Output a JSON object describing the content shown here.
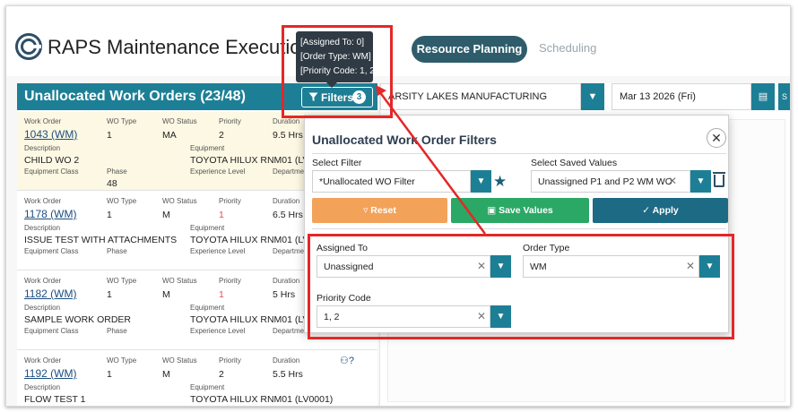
{
  "header": {
    "app_title": "RAPS Maintenance Execution P",
    "tabs": [
      "Resource Planning",
      "Scheduling"
    ]
  },
  "left_panel": {
    "title": "Unallocated Work Orders (23/48)",
    "filters_label": "Filters",
    "filters_count": "3",
    "labels": {
      "work_order": "Work Order",
      "wo_type": "WO Type",
      "wo_status": "WO Status",
      "priority": "Priority",
      "duration": "Duration",
      "description": "Description",
      "equipment": "Equipment",
      "equipment_class": "Equipment Class",
      "phase": "Phase",
      "experience_level": "Experience Level",
      "department": "Departme"
    },
    "work_orders": [
      {
        "number": "1043 (WM)",
        "type": "1",
        "status": "MA",
        "priority": "2",
        "duration": "9.5 Hrs",
        "description": "CHILD WO 2",
        "equipment": "TOYOTA HILUX RNM01 (LV0",
        "phase": "48"
      },
      {
        "number": "1178 (WM)",
        "type": "1",
        "status": "M",
        "priority": "1",
        "duration": "6.5 Hrs",
        "description": "ISSUE TEST WITH ATTACHMENTS",
        "equipment": "TOYOTA HILUX RNM01 (LV0",
        "phase": ""
      },
      {
        "number": "1182 (WM)",
        "type": "1",
        "status": "M",
        "priority": "1",
        "duration": "5 Hrs",
        "description": "SAMPLE WORK ORDER",
        "equipment": "TOYOTA HILUX RNM01 (LV0",
        "phase": ""
      },
      {
        "number": "1192 (WM)",
        "type": "1",
        "status": "M",
        "priority": "2",
        "duration": "5.5 Hrs",
        "description": "FLOW TEST 1",
        "equipment": "TOYOTA HILUX RNM01 (LV0001)",
        "phase": ""
      }
    ],
    "priority_color_high": "#e05050",
    "icon_glyph": "⚇?"
  },
  "tooltip": {
    "lines": [
      "[Assigned To: 0]",
      "[Order Type: WM]",
      "[Priority Code: 1, 2]"
    ]
  },
  "right_area": {
    "site": "ARSITY LAKES MANUFACTURING",
    "date": "Mar 13 2026 (Fri)",
    "extra": "S"
  },
  "dialog": {
    "title": "Unallocated Work Order Filters",
    "select_filter_label": "Select Filter",
    "select_filter_value": "*Unallocated WO Filter",
    "saved_values_label": "Select Saved Values",
    "saved_values_value": "Unassigned P1 and P2 WM WO",
    "reset_label": "Reset",
    "save_label": "Save Values",
    "apply_label": "Apply",
    "assigned_to_label": "Assigned To",
    "assigned_to_value": "Unassigned",
    "order_type_label": "Order Type",
    "order_type_value": "WM",
    "priority_code_label": "Priority Code",
    "priority_code_value": "1, 2"
  },
  "colors": {
    "teal": "#1d7f95",
    "dark_teal": "#2e5c6b",
    "orange": "#f3a25a",
    "green": "#2ba866",
    "apply_blue": "#1d6a85",
    "callout_red": "#e52727",
    "selected_row": "#fcf8e3"
  },
  "icons": {
    "logo": "raps-logo-icon",
    "filter": "funnel-icon",
    "dropdown": "chevron-down-icon",
    "calendar": "calendar-icon",
    "close": "close-icon",
    "clear": "clear-x-icon",
    "star": "star-icon",
    "trash": "trash-icon",
    "reset": "reset-funnel-icon",
    "save": "floppy-icon",
    "apply": "check-icon",
    "assign": "people-icon"
  }
}
